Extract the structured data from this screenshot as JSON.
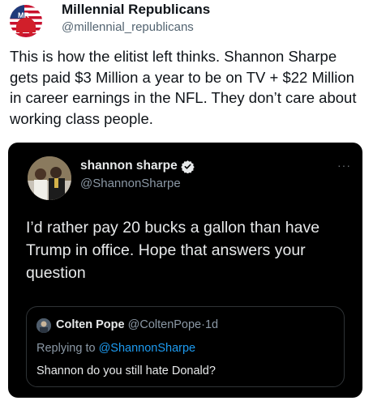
{
  "outer_tweet": {
    "display_name": "Millennial Republicans",
    "handle": "@millennial_republicans",
    "logo_text": "MR",
    "text": "This is how the elitist left thinks. Shannon Sharpe gets paid $3 Million a year to be on TV + $22 Million in career earnings in the NFL. They don’t care about working class people."
  },
  "embedded_tweet": {
    "display_name": "shannon sharpe",
    "verified": true,
    "handle": "@ShannonSharpe",
    "more_icon": "ellipsis-icon",
    "text": "I’d rather pay 20 bucks a gallon than have Trump in office. Hope that answers your question",
    "quoted_tweet": {
      "display_name": "Colten Pope",
      "handle": "@ColtenPope",
      "separator": "·",
      "time": "1d",
      "replying_prefix": "Replying to",
      "replying_to": "@ShannonSharpe",
      "text": "Shannon do you still hate Donald?"
    }
  },
  "colors": {
    "card_background": "#000000",
    "link_blue": "#1d9bf0",
    "verified_blue": "#1d9bf0",
    "secondary_text": "#536471"
  }
}
